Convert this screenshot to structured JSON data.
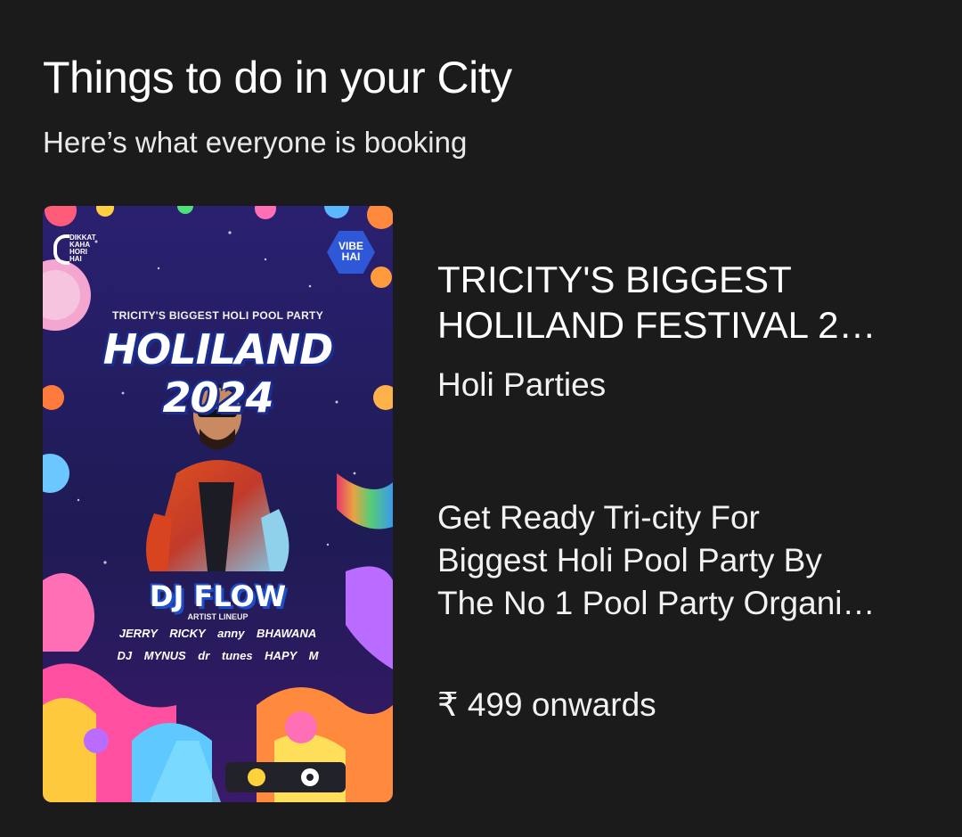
{
  "section": {
    "title": "Things to do in your City",
    "subtitle": "Here’s what everyone is booking"
  },
  "event": {
    "title_line1": "TRICITY'S BIGGEST",
    "title_line2": "HOLILAND FESTIVAL 2…",
    "category": "Holi Parties",
    "description_line1": "Get Ready Tri-city For",
    "description_line2": "Biggest Holi Pool Party By",
    "description_line3": "The No 1 Pool Party Organi…",
    "price": "₹ 499 onwards",
    "poster": {
      "brand_logo": [
        "DIKKAT",
        "KAHA",
        "HORI",
        "HAI"
      ],
      "badge_line1": "VIBE",
      "badge_line2": "HAI",
      "tagline": "TRICITY'S BIGGEST HOLI POOL PARTY",
      "headline": "HOLILAND 2024",
      "headliner": "DJ FLOW",
      "lineup_label": "ARTIST LINEUP",
      "artists_row1": "JERRY  RICKY  anny  BHAWANA",
      "artists_row2": "DJ MYNUS  dr tunes  HAPY  M"
    }
  },
  "colors": {
    "background": "#1b1b1c",
    "text_primary": "#ffffff",
    "poster_sky": "#241c5c"
  }
}
